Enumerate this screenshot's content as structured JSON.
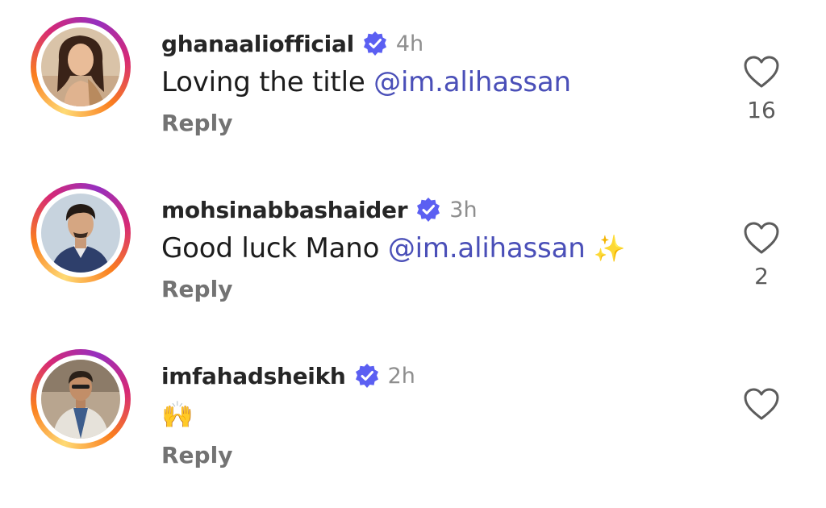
{
  "comments": [
    {
      "username": "ghanaaliofficial",
      "time": "4h",
      "text": "Loving the title ",
      "mention": "@im.alihassan",
      "emoji": "",
      "reply_label": "Reply",
      "likes": "16",
      "verified": true
    },
    {
      "username": "mohsinabbashaider",
      "time": "3h",
      "text": "Good luck Mano ",
      "mention": "@im.alihassan",
      "emoji": " ✨",
      "reply_label": "Reply",
      "likes": "2",
      "verified": true
    },
    {
      "username": "imfahadsheikh",
      "time": "2h",
      "text": "",
      "mention": "",
      "emoji": "🙌",
      "reply_label": "Reply",
      "likes": "",
      "verified": true
    }
  ],
  "icons": {
    "like": "heart-outline-icon",
    "verified": "verified-badge-icon"
  },
  "colors": {
    "mention": "#4a4fb8",
    "verified": "#5b5ff2",
    "muted": "#8e8e8e"
  }
}
